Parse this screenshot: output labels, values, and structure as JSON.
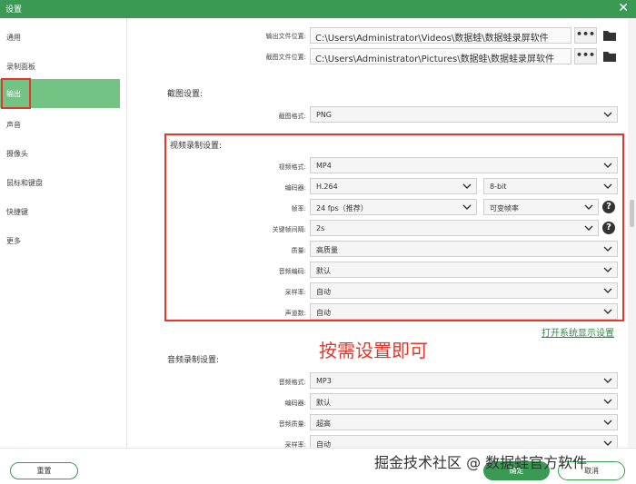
{
  "window": {
    "title": "设置",
    "close_glyph": "✕"
  },
  "sidebar": {
    "items": [
      {
        "label": "通用"
      },
      {
        "label": "录制面板"
      },
      {
        "label": "输出",
        "active": true
      },
      {
        "label": "声音"
      },
      {
        "label": "摄像头"
      },
      {
        "label": "鼠标和键盘"
      },
      {
        "label": "快捷键"
      },
      {
        "label": "更多"
      }
    ]
  },
  "output": {
    "video_location_label": "输出文件位置:",
    "video_location_value": "C:\\Users\\Administrator\\Videos\\数据蛙\\数据蛙录屏软件",
    "screenshot_location_label": "截图文件位置:",
    "screenshot_location_value": "C:\\Users\\Administrator\\Pictures\\数据蛙\\数据蛙录屏软件",
    "browse_glyph": "•••"
  },
  "screenshot_settings": {
    "section_title": "截图设置:",
    "format_label": "截图格式:",
    "format_value": "PNG"
  },
  "video_settings": {
    "section_title": "视频录制设置:",
    "format_label": "视频格式:",
    "format_value": "MP4",
    "encoder_label": "编码器:",
    "encoder_value": "H.264",
    "bitdepth_value": "8-bit",
    "framerate_label": "帧率:",
    "framerate_value": "24 fps（推荐）",
    "framerate_mode_value": "可变帧率",
    "keyframe_label": "关键帧间隔:",
    "keyframe_value": "2s",
    "quality_label": "质量:",
    "quality_value": "高质量",
    "audio_codec_label": "音频编码:",
    "audio_codec_value": "默认",
    "samplerate_label": "采样率:",
    "samplerate_value": "自动",
    "channels_label": "声道数:",
    "channels_value": "自动",
    "help_glyph": "?"
  },
  "annotation": "按需设置即可",
  "display_settings_link": "打开系统显示设置",
  "audio_settings": {
    "section_title": "音频录制设置:",
    "format_label": "音频格式:",
    "format_value": "MP3",
    "encoder_label": "编码器:",
    "encoder_value": "默认",
    "quality_label": "音频质量:",
    "quality_value": "超高",
    "samplerate_label": "采样率:",
    "samplerate_value": "自动"
  },
  "footer": {
    "reset_label": "重置",
    "ok_label": "确定",
    "cancel_label": "取消"
  },
  "watermark": "掘金技术社区 @ 数据蛙官方软件",
  "colors": {
    "accent": "#3a9a54",
    "active_item": "#72c384",
    "highlight": "#e8352b"
  }
}
